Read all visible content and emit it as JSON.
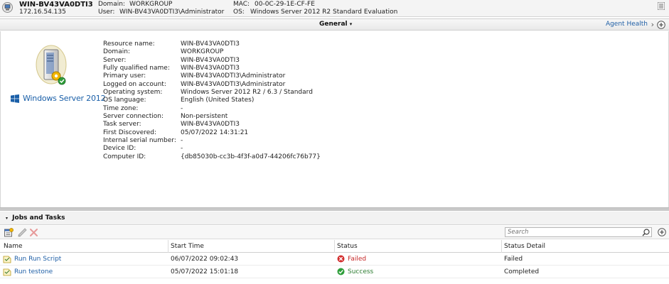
{
  "header": {
    "computer_name": "WIN-BV43VA0DTI3",
    "ip_address": "172.16.54.135",
    "domain_label": "Domain:",
    "domain_value": "WORKGROUP",
    "user_label": "User:",
    "user_value": "WIN-BV43VA0DTI3\\Administrator",
    "mac_label": "MAC:",
    "mac_value": "00-0C-29-1E-CF-FE",
    "os_label": "OS:",
    "os_value": "Windows Server 2012 R2 Standard Evaluation"
  },
  "general_bar": {
    "title": "General",
    "caret": "▾",
    "agent_health": "Agent Health",
    "chevron": "›"
  },
  "logo_text": "Windows Server 2012",
  "properties": [
    {
      "label": "Resource name:",
      "value": "WIN-BV43VA0DTI3"
    },
    {
      "label": "Domain:",
      "value": "WORKGROUP"
    },
    {
      "label": "Server:",
      "value": "WIN-BV43VA0DTI3"
    },
    {
      "label": "Fully qualified name:",
      "value": "WIN-BV43VA0DTI3"
    },
    {
      "label": "Primary user:",
      "value": "WIN-BV43VA0DTI3\\Administrator"
    },
    {
      "label": "Logged on account:",
      "value": "WIN-BV43VA0DTI3\\Administrator"
    },
    {
      "label": "Operating system:",
      "value": "Windows Server 2012 R2 / 6.3 / Standard"
    },
    {
      "label": "OS language:",
      "value": "English (United States)"
    },
    {
      "label": "Time zone:",
      "value": "-"
    },
    {
      "label": "Server connection:",
      "value": "Non-persistent"
    },
    {
      "label": "Task server:",
      "value": "WIN-BV43VA0DTI3"
    },
    {
      "label": "First Discovered:",
      "value": "05/07/2022 14:31:21"
    },
    {
      "label": "Internal serial number:",
      "value": "-"
    },
    {
      "label": "Device ID:",
      "value": "-"
    },
    {
      "label": "Computer ID:",
      "value": "{db85030b-cc3b-4f3f-a0d7-44206fc76b77}"
    }
  ],
  "jobs": {
    "section_title": "Jobs and Tasks",
    "caret": "▾",
    "search_placeholder": "Search",
    "columns": {
      "name": "Name",
      "start_time": "Start Time",
      "status": "Status",
      "status_detail": "Status Detail"
    },
    "rows": [
      {
        "name": "Run Run Script",
        "start_time": "06/07/2022 09:02:43",
        "status": "Failed",
        "status_detail": "Failed"
      },
      {
        "name": "Run testone",
        "start_time": "05/07/2022 15:01:18",
        "status": "Success",
        "status_detail": "Completed"
      }
    ]
  },
  "colors": {
    "link": "#1f5fa6",
    "failed": "#c62828",
    "success": "#2e7d32",
    "windows_blue": "#1a5fa8"
  },
  "icons": [
    "computer-icon",
    "menu-icon",
    "nav-circle-icon",
    "server-image",
    "windows-flag-icon",
    "new-job-icon",
    "edit-icon",
    "delete-icon",
    "search-icon",
    "refresh-icon",
    "task-icon",
    "failed-icon",
    "success-icon"
  ]
}
